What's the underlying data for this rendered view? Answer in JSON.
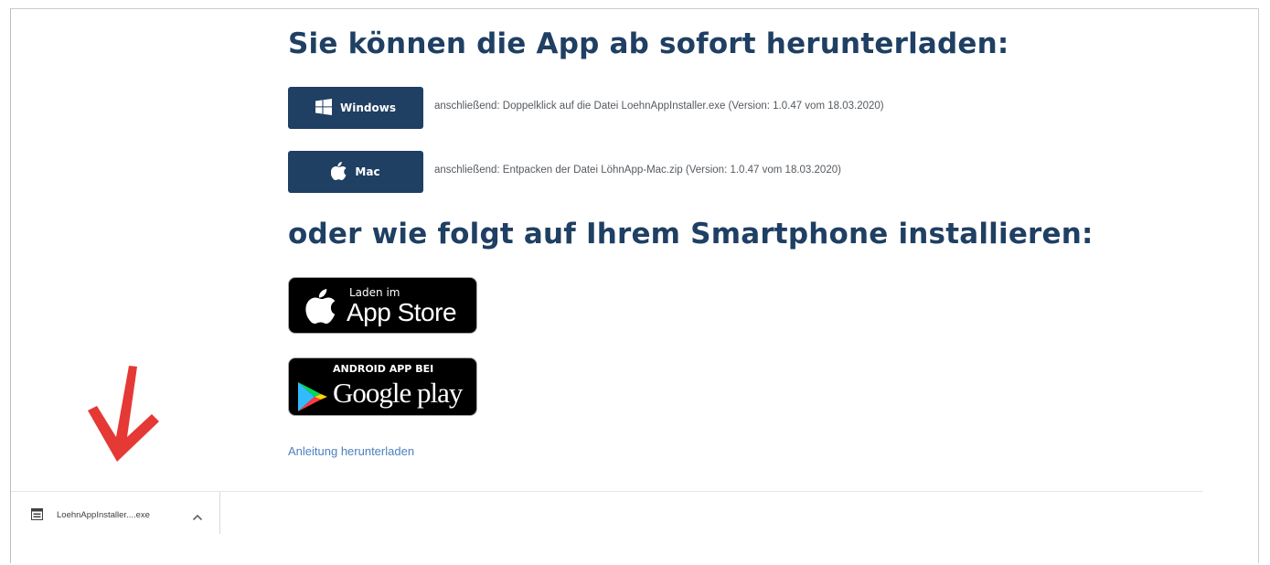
{
  "headings": {
    "download_now": "Sie können die App ab sofort herunterladen:",
    "smartphone": "oder wie folgt auf Ihrem Smartphone installieren:"
  },
  "desktop_downloads": {
    "windows": {
      "label": "Windows",
      "icon": "windows-logo-icon",
      "note": "anschließend: Doppelklick auf die Datei LoehnAppInstaller.exe (Version: 1.0.47 vom 18.03.2020)"
    },
    "mac": {
      "label": "Mac",
      "icon": "apple-logo-icon",
      "note": "anschließend: Entpacken der Datei LöhnApp-Mac.zip (Version: 1.0.47 vom 18.03.2020)"
    }
  },
  "store_badges": {
    "app_store": {
      "small_text": "Laden im",
      "big_text": "App Store",
      "icon": "apple-logo-icon"
    },
    "google_play": {
      "small_text": "ANDROID APP BEI",
      "big_text": "Google play",
      "icon": "google-play-icon"
    }
  },
  "manual_link": "Anleitung herunterladen",
  "download_bar": {
    "filename": "LoehnAppInstaller....exe",
    "file_icon": "file-icon",
    "chevron_icon": "chevron-up-icon"
  },
  "annotation": {
    "icon": "red-arrow-down-icon",
    "color": "#e53935"
  },
  "colors": {
    "brand_navy": "#1f3f63",
    "link_blue": "#4f7fc0"
  }
}
